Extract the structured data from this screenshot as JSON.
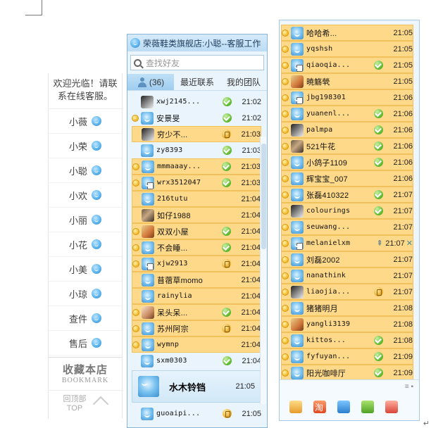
{
  "service_panel": {
    "welcome": "欢迎光临！请联系在线客服。",
    "agents": [
      "小薇",
      "小荣",
      "小聪",
      "小欢",
      "小丽",
      "小花",
      "小美",
      "小琼",
      "查件",
      "售后"
    ],
    "bookmark_cn": "收藏本店",
    "bookmark_en": "BOOKMARK",
    "top_cn": "回顶部",
    "top_en": "TOP"
  },
  "qq1": {
    "title": "荣薇鞋类旗舰店:小聪--客服工作",
    "search_placeholder": "查找好友",
    "tabs": [
      {
        "label": "(36)"
      },
      {
        "label": "最近联系"
      },
      {
        "label": "我的团队"
      }
    ],
    "rows": [
      {
        "name": "xwj2145...",
        "status": "ok",
        "time": "21:02",
        "hl": false,
        "dot": false,
        "avatar": "photo3",
        "mono": true
      },
      {
        "name": "安景旻",
        "status": "ok",
        "time": "21:02",
        "hl": false,
        "dot": true,
        "avatar": "qq",
        "mono": false
      },
      {
        "name": "穷少不...",
        "status": "mobile",
        "time": "21:03",
        "hl": true,
        "dot": false,
        "avatar": "photo3",
        "mono": false
      },
      {
        "name": "zy8393",
        "status": "ok",
        "time": "21:03",
        "hl": false,
        "dot": false,
        "avatar": "qq",
        "mono": true
      },
      {
        "name": "mmmaaay...",
        "status": "ok",
        "time": "21:03",
        "hl": true,
        "dot": true,
        "avatar": "qq",
        "mono": true
      },
      {
        "name": "wrx3512047",
        "status": "ok",
        "time": "21:03",
        "hl": true,
        "dot": true,
        "avatar": "qq-doc",
        "mono": true
      },
      {
        "name": "216tutu",
        "status": "none",
        "time": "21:04",
        "hl": true,
        "dot": false,
        "avatar": "qq",
        "mono": true
      },
      {
        "name": "如仔1988",
        "status": "none",
        "time": "21:04",
        "hl": true,
        "dot": false,
        "avatar": "photo",
        "mono": false
      },
      {
        "name": "双双小屋",
        "status": "ok",
        "time": "21:04",
        "hl": true,
        "dot": true,
        "avatar": "photo2",
        "mono": false
      },
      {
        "name": "不会睡...",
        "status": "ok",
        "time": "21:04",
        "hl": true,
        "dot": true,
        "avatar": "qq",
        "mono": false
      },
      {
        "name": "xjw2913",
        "status": "mobile",
        "time": "21:04",
        "hl": true,
        "dot": true,
        "avatar": "qq-doc",
        "mono": true
      },
      {
        "name": "苜蓿草momo",
        "status": "none",
        "time": "21:04",
        "hl": true,
        "dot": false,
        "avatar": "qq",
        "mono": false
      },
      {
        "name": "rainylia",
        "status": "none",
        "time": "21:04",
        "hl": true,
        "dot": false,
        "avatar": "qq",
        "mono": true
      },
      {
        "name": "呆头呆...",
        "status": "ok",
        "time": "21:04",
        "hl": true,
        "dot": true,
        "avatar": "photo4",
        "mono": false
      },
      {
        "name": "苏州阿宗",
        "status": "mobile",
        "time": "21:04",
        "hl": true,
        "dot": true,
        "avatar": "qq",
        "mono": false
      },
      {
        "name": "wymnp",
        "status": "none",
        "time": "21:04",
        "hl": true,
        "dot": true,
        "avatar": "qq",
        "mono": true
      },
      {
        "name": "sxm0303",
        "status": "ok",
        "time": "21:04",
        "hl": false,
        "dot": false,
        "avatar": "qq",
        "mono": true
      }
    ],
    "big_entry": {
      "name": "水木铃铛",
      "time": "21:05"
    },
    "last_row": {
      "name": "guoaipi...",
      "status": "mobile",
      "time": "21:05"
    }
  },
  "qq2": {
    "rows": [
      {
        "name": "哈哈希...",
        "status": "none",
        "time": "21:05",
        "dot": true,
        "avatar": "qq",
        "mono": false
      },
      {
        "name": "yqshsh",
        "status": "none",
        "time": "21:05",
        "dot": true,
        "avatar": "qq",
        "mono": true
      },
      {
        "name": "qiaoqia...",
        "status": "ok",
        "time": "21:05",
        "dot": true,
        "avatar": "qq-doc",
        "mono": true
      },
      {
        "name": "暁觞煢",
        "status": "none",
        "time": "21:05",
        "dot": true,
        "avatar": "photo2",
        "mono": false
      },
      {
        "name": "jbg198301",
        "status": "none",
        "time": "21:06",
        "dot": true,
        "avatar": "qq-doc",
        "mono": true
      },
      {
        "name": "yuanenl...",
        "status": "ok",
        "time": "21:06",
        "dot": true,
        "avatar": "qq",
        "mono": true
      },
      {
        "name": "palmpa",
        "status": "ok",
        "time": "21:06",
        "dot": true,
        "avatar": "photo3",
        "mono": true
      },
      {
        "name": "521牛花",
        "status": "ok",
        "time": "21:06",
        "dot": true,
        "avatar": "photo",
        "mono": false
      },
      {
        "name": "小鸽子1109",
        "status": "ok",
        "time": "21:06",
        "dot": true,
        "avatar": "qq",
        "mono": false
      },
      {
        "name": "辉宝宝_007",
        "status": "none",
        "time": "21:06",
        "dot": true,
        "avatar": "qq",
        "mono": false
      },
      {
        "name": "张磊410322",
        "status": "ok",
        "time": "21:07",
        "dot": true,
        "avatar": "qq",
        "mono": false
      },
      {
        "name": "colourings",
        "status": "ok",
        "time": "21:07",
        "dot": true,
        "avatar": "photo3",
        "mono": true
      },
      {
        "name": "seuwang...",
        "status": "none",
        "time": "21:07",
        "dot": true,
        "avatar": "qq",
        "mono": true
      },
      {
        "name": "melanielxm",
        "status": "pin",
        "time": "21:07",
        "dot": true,
        "avatar": "qq-doc",
        "mono": true
      },
      {
        "name": "刘磊2002",
        "status": "none",
        "time": "21:07",
        "dot": true,
        "avatar": "qq",
        "mono": false
      },
      {
        "name": "nanathink",
        "status": "none",
        "time": "21:07",
        "dot": true,
        "avatar": "qq",
        "mono": true
      },
      {
        "name": "liaojia...",
        "status": "mobile",
        "time": "21:07",
        "dot": true,
        "avatar": "photo3",
        "mono": true
      },
      {
        "name": "猪猪明月",
        "status": "none",
        "time": "21:08",
        "dot": true,
        "avatar": "qq",
        "mono": false
      },
      {
        "name": "yangli3139",
        "status": "none",
        "time": "21:08",
        "dot": true,
        "avatar": "photo2",
        "mono": true
      },
      {
        "name": "kittos...",
        "status": "ok",
        "time": "21:08",
        "dot": true,
        "avatar": "qq",
        "mono": true
      },
      {
        "name": "fyfuyan...",
        "status": "ok",
        "time": "21:09",
        "dot": true,
        "avatar": "qq",
        "mono": true
      },
      {
        "name": "阳光咖啡厅",
        "status": "ok",
        "time": "21:09",
        "dot": true,
        "avatar": "qq",
        "mono": false
      }
    ],
    "bottom_icons": [
      "manager-icon",
      "taobao-icon",
      "box-icon",
      "gift-icon",
      "shop-icon"
    ]
  }
}
